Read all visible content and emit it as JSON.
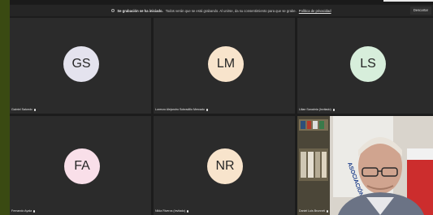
{
  "banner": {
    "bold_text": "Se grabación se ha iniciado.",
    "text": "Todos verán que se está grabando. Al unirse, da su consentimiento para que se grabe.",
    "link_text": "Política de privacidad",
    "dismiss_label": "Descartar"
  },
  "participants": [
    {
      "initials": "GS",
      "name": "Gabriel Salcedo",
      "avatar_color": "#e4e3ee"
    },
    {
      "initials": "LM",
      "name": "Lorenzo Alejandro Sobradillo Mercado",
      "avatar_color": "#f8e4cc"
    },
    {
      "initials": "LS",
      "name": "Lilian Sanabria (Invitado)",
      "avatar_color": "#d7eedb"
    },
    {
      "initials": "FA",
      "name": "Fernando Ayala",
      "avatar_color": "#f9dfe9"
    },
    {
      "initials": "NR",
      "name": "Nilda Riveros (Invitado)",
      "avatar_color": "#f8e4cc"
    },
    {
      "initials": "",
      "name": "Daniel Luis Brunneti",
      "avatar_color": ""
    }
  ]
}
